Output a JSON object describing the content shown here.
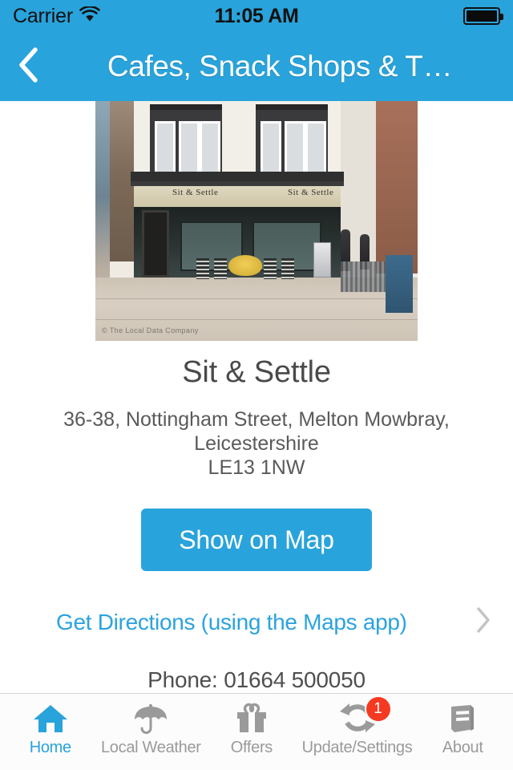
{
  "status_bar": {
    "carrier": "Carrier",
    "wifi_icon": "wifi-icon",
    "time": "11:05 AM",
    "battery_icon": "battery-full-icon"
  },
  "nav_bar": {
    "back_icon": "chevron-left-icon",
    "title": "Cafes, Snack Shops & T…",
    "background_color": "#29A3DB"
  },
  "listing": {
    "photo": {
      "alt": "storefront-photo",
      "sign_text_left": "Sit & Settle",
      "sign_text_right": "Sit & Settle",
      "watermark": "© The Local Data Company"
    },
    "name": "Sit & Settle",
    "address_line1": "36-38, Nottingham Street, Melton Mowbray,",
    "address_line2": "Leicestershire",
    "address_line3": "LE13 1NW",
    "map_button_label": "Show on Map",
    "directions_label": "Get Directions (using the Maps app)",
    "directions_chevron_icon": "chevron-right-icon",
    "phone": "Phone: 01664 500050"
  },
  "tab_bar": {
    "active_color": "#29A3DB",
    "inactive_color": "#9A9A9A",
    "badge_color": "#F53A22",
    "items": [
      {
        "label": "Home",
        "icon": "home-icon",
        "active": true,
        "badge": ""
      },
      {
        "label": "Local Weather",
        "icon": "umbrella-icon",
        "active": false,
        "badge": ""
      },
      {
        "label": "Offers",
        "icon": "gift-icon",
        "active": false,
        "badge": ""
      },
      {
        "label": "Update/Settings",
        "icon": "refresh-icon",
        "active": false,
        "badge": "1"
      },
      {
        "label": "About",
        "icon": "book-icon",
        "active": false,
        "badge": ""
      }
    ]
  }
}
